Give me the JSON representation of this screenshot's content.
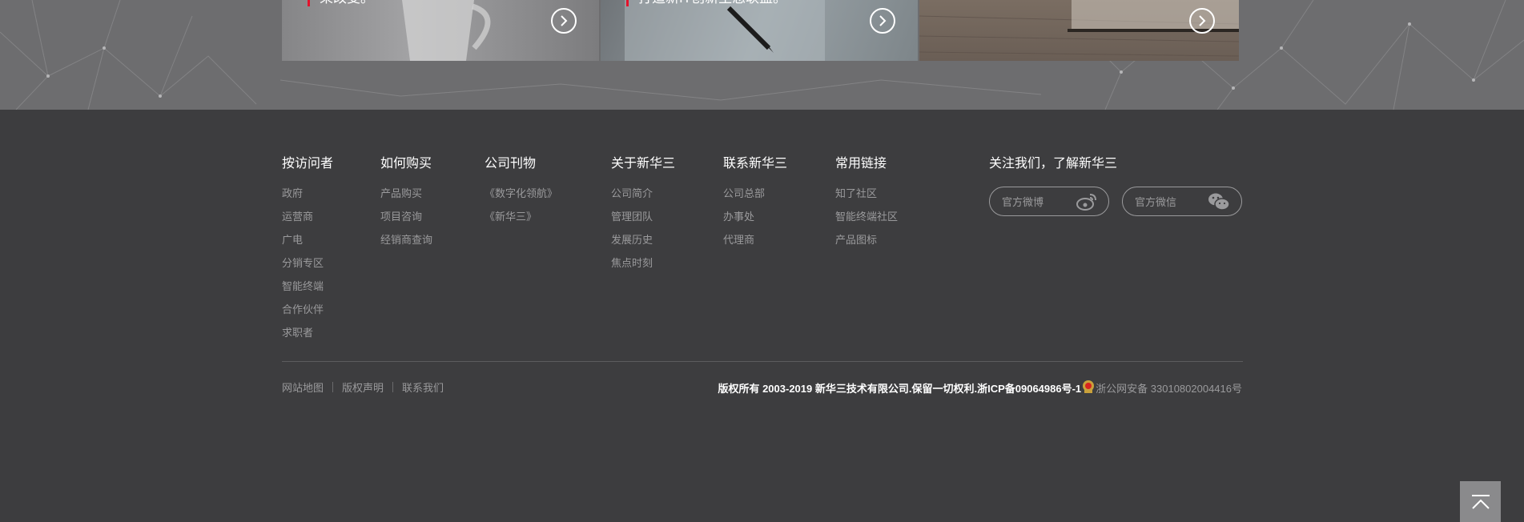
{
  "banner": {
    "cards": [
      {
        "caption": "束改变。"
      },
      {
        "caption": "打造新IT创新生态联盟。"
      },
      {
        "caption": ""
      }
    ]
  },
  "footer": {
    "columns": [
      {
        "title": "按访问者",
        "links": [
          "政府",
          "运营商",
          "广电",
          "分销专区",
          "智能终端",
          "合作伙伴",
          "求职者"
        ]
      },
      {
        "title": "如何购买",
        "links": [
          "产品购买",
          "项目咨询",
          "经销商查询"
        ]
      },
      {
        "title": "公司刊物",
        "links": [
          "《数字化领航》",
          "《新华三》"
        ]
      },
      {
        "title": "关于新华三",
        "links": [
          "公司简介",
          "管理团队",
          "发展历史",
          "焦点时刻"
        ]
      },
      {
        "title": "联系新华三",
        "links": [
          "公司总部",
          "办事处",
          "代理商"
        ]
      },
      {
        "title": "常用链接",
        "links": [
          "知了社区",
          "智能终端社区",
          "产品图标"
        ]
      }
    ],
    "follow": {
      "title": "关注我们，了解新华三",
      "weibo_label": "官方微博",
      "wechat_label": "官方微信"
    },
    "bottom_links": [
      "网站地图",
      "版权声明",
      "联系我们"
    ],
    "copyright": "版权所有 2003-2019 新华三技术有限公司.保留一切权利.浙ICP备09064986号-1",
    "police_record": "浙公网安备 33010802004416号"
  },
  "colors": {
    "accent": "#e3122b",
    "footer_bg": "#3d3d3f",
    "link": "#9a9a9c"
  }
}
